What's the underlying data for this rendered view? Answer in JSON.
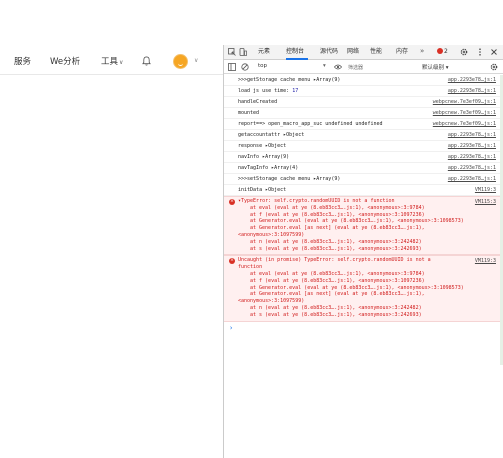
{
  "page_nav": {
    "items": [
      "服务",
      "We分析",
      "工具"
    ],
    "tools_dropdown": "∨",
    "avatar_caret": "∨"
  },
  "devtools": {
    "tabs": [
      "元素",
      "控制台",
      "源代码",
      "网络",
      "性能",
      "内存"
    ],
    "active_tab": "控制台",
    "more_tabs": "»",
    "error_count": "2",
    "context": "top",
    "filter_placeholder": "筛选器",
    "level": "默认级别 ▾"
  },
  "console_logs": [
    {
      "msg": ">>>getStorage cache menu ▸Array(9)",
      "src": "app.2293e78…js:1"
    },
    {
      "msg": "load js use time: ",
      "num": "17",
      "src": "app.2293e78…js:1"
    },
    {
      "msg": "handleCreated",
      "src": "webpcnew.7e3ef09…js:1"
    },
    {
      "msg": "mounted",
      "src": "webpcnew.7e3ef09…js:1"
    },
    {
      "msg": "report==> open_macro_app_suc undefined undefined",
      "src": "webpcnew.7e3ef09…js:1"
    },
    {
      "msg": "getaccountattr ▸Object",
      "src": "app.2293e78…js:1"
    },
    {
      "msg": "response ▸Object",
      "src": "app.2293e78…js:1"
    },
    {
      "msg": "navInfo ▸Array(9)",
      "src": "app.2293e78…js:1"
    },
    {
      "msg": "navTagInfo ▸Array(4)",
      "src": "app.2293e78…js:1"
    },
    {
      "msg": ">>>setStorage cache menu ▸Array(9)",
      "src": "app.2293e78…js:1"
    },
    {
      "msg": "initData ▸Object",
      "src": "VM119:3"
    }
  ],
  "errors": [
    {
      "src": "VM115:3",
      "lines": [
        {
          "t": "▾TypeError: self.crypto.randomUUID is not a function",
          "i": false
        },
        {
          "t": "at eval (eval at ye (8.eb83cc3….js:1), <anonymous>:3:9784)",
          "i": true
        },
        {
          "t": "at f (eval at ye (8.eb83cc3….js:1), <anonymous>:3:1097236)",
          "i": true
        },
        {
          "t": "at Generator.eval (eval at ye (8.eb83cc3….js:1), <anonymous>:3:1098573)",
          "i": true
        },
        {
          "t": "at Generator.eval [as next] (eval at ye (8.eb83cc3….js:1),",
          "i": true
        },
        {
          "t": "<anonymous>:3:1097599)",
          "i": false
        },
        {
          "t": "at n (eval at ye (8.eb83cc3….js:1), <anonymous>:3:242482)",
          "i": true
        },
        {
          "t": "at s (eval at ye (8.eb83cc3….js:1), <anonymous>:3:242693)",
          "i": true
        }
      ]
    },
    {
      "src": "VM119:3",
      "lines": [
        {
          "t": "Uncaught (in promise) TypeError: self.crypto.randomUUID is not a",
          "i": false
        },
        {
          "t": "function",
          "i": false
        },
        {
          "t": "at eval (eval at ye (8.eb83cc3….js:1), <anonymous>:3:9784)",
          "i": true
        },
        {
          "t": "at f (eval at ye (8.eb83cc3….js:1), <anonymous>:3:1097236)",
          "i": true
        },
        {
          "t": "at Generator.eval (eval at ye (8.eb83cc3….js:1), <anonymous>:3:1098573)",
          "i": true
        },
        {
          "t": "at Generator.eval [as next] (eval at ye (8.eb83cc3….js:1),",
          "i": true
        },
        {
          "t": "<anonymous>:3:1097599)",
          "i": false
        },
        {
          "t": "at n (eval at ye (8.eb83cc3….js:1), <anonymous>:3:242482)",
          "i": true
        },
        {
          "t": "at s (eval at ye (8.eb83cc3….js:1), <anonymous>:3:242693)",
          "i": true
        }
      ]
    }
  ],
  "console_prompt": "›",
  "colors": {
    "accent": "#1a73e8",
    "error_text": "#d01a1a",
    "error_bg": "#fff0f0",
    "avatar": "#f6a623"
  },
  "icons": [
    "inspect-icon",
    "device-toggle-icon",
    "gear-icon",
    "kebab-menu-icon",
    "close-icon",
    "sidebar-toggle-icon",
    "clear-console-icon",
    "eye-icon",
    "settings-icon",
    "bell-icon"
  ]
}
